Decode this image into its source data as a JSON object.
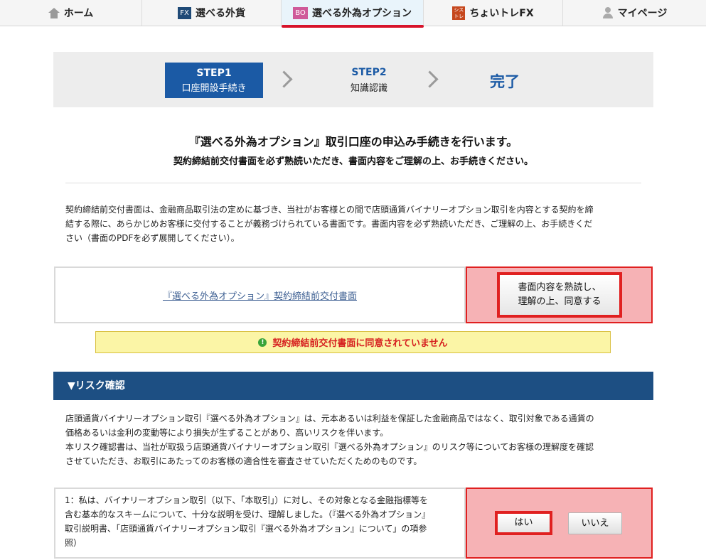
{
  "nav": {
    "home": {
      "label": "ホーム",
      "icon": "home-icon"
    },
    "fx": {
      "label": "選べる外貨",
      "icon_text": "FX"
    },
    "bo": {
      "label": "選べる外為オプション",
      "icon_text": "BO"
    },
    "shisutore": {
      "label": "ちょいトレFX",
      "icon_text": "シス\nトレ"
    },
    "mypage": {
      "label": "マイページ",
      "icon": "user-icon"
    },
    "active": "選べる外為オプション",
    "active_underline_color": "#d7132a"
  },
  "steps": {
    "step1": {
      "title": "STEP1",
      "sub": "口座開設手続き"
    },
    "step2": {
      "title": "STEP2",
      "sub": "知識認識"
    },
    "step3": {
      "title": "完了"
    }
  },
  "heading": {
    "main": "『選べる外為オプション』取引口座の申込み手続きを行います。",
    "sub": "契約締結前交付書面を必ず熟読いただき、書面内容をご理解の上、お手続きください。"
  },
  "intro": {
    "lines": [
      "契約締結前交付書面は、金融商品取引法の定めに基づき、当社がお客様との間で店頭通貨バイナリーオプション取引を内容とする契約を締",
      "結する際に、あらかじめお客様に交付することが義務づけられている書面です。書面内容を必ず熟読いただき、ご理解の上、お手続きくだ",
      "さい（書面のPDFを必ず展開してください）。"
    ]
  },
  "document": {
    "link": "『選べる外為オプション』契約締結前交付書面",
    "agree_button_line1": "書面内容を熟読し、",
    "agree_button_line2": "理解の上、同意する"
  },
  "warning": {
    "text": "契約締結前交付書面に同意されていません"
  },
  "risk": {
    "title": "▼リスク確認",
    "lines": [
      "店頭通貨バイナリーオプション取引『選べる外為オプション』は、元本あるいは利益を保証した金融商品ではなく、取引対象である通貨の",
      "価格あるいは金利の変動等により損失が生ずることがあり、高いリスクを伴います。",
      "本リスク確認書は、当社が取扱う店頭通貨バイナリーオプション取引『選べる外為オプション』のリスク等についてお客様の理解度を確認",
      "させていただき、お取引にあたってのお客様の適合性を審査させていただくためのものです。"
    ],
    "question1": {
      "lines": [
        "1：私は、バイナリーオプション取引（以下、「本取引」）に対し、その対象となる金融指標等を",
        "含む基本的なスキームについて、十分な説明を受け、理解しました。（『選べる外為オプション』",
        "取引説明書、「店頭通貨バイナリーオプション取引『選べる外為オプション』について」の項参",
        "照）"
      ],
      "yes": "はい",
      "no": "いいえ"
    }
  },
  "colors": {
    "brand_blue": "#1b5aa5",
    "section_bar": "#1d4f83",
    "highlight_red": "#e02020",
    "highlight_pink": "#f6b2b5",
    "warning_bg": "#fbf5a6",
    "warning_text": "#d62020"
  }
}
